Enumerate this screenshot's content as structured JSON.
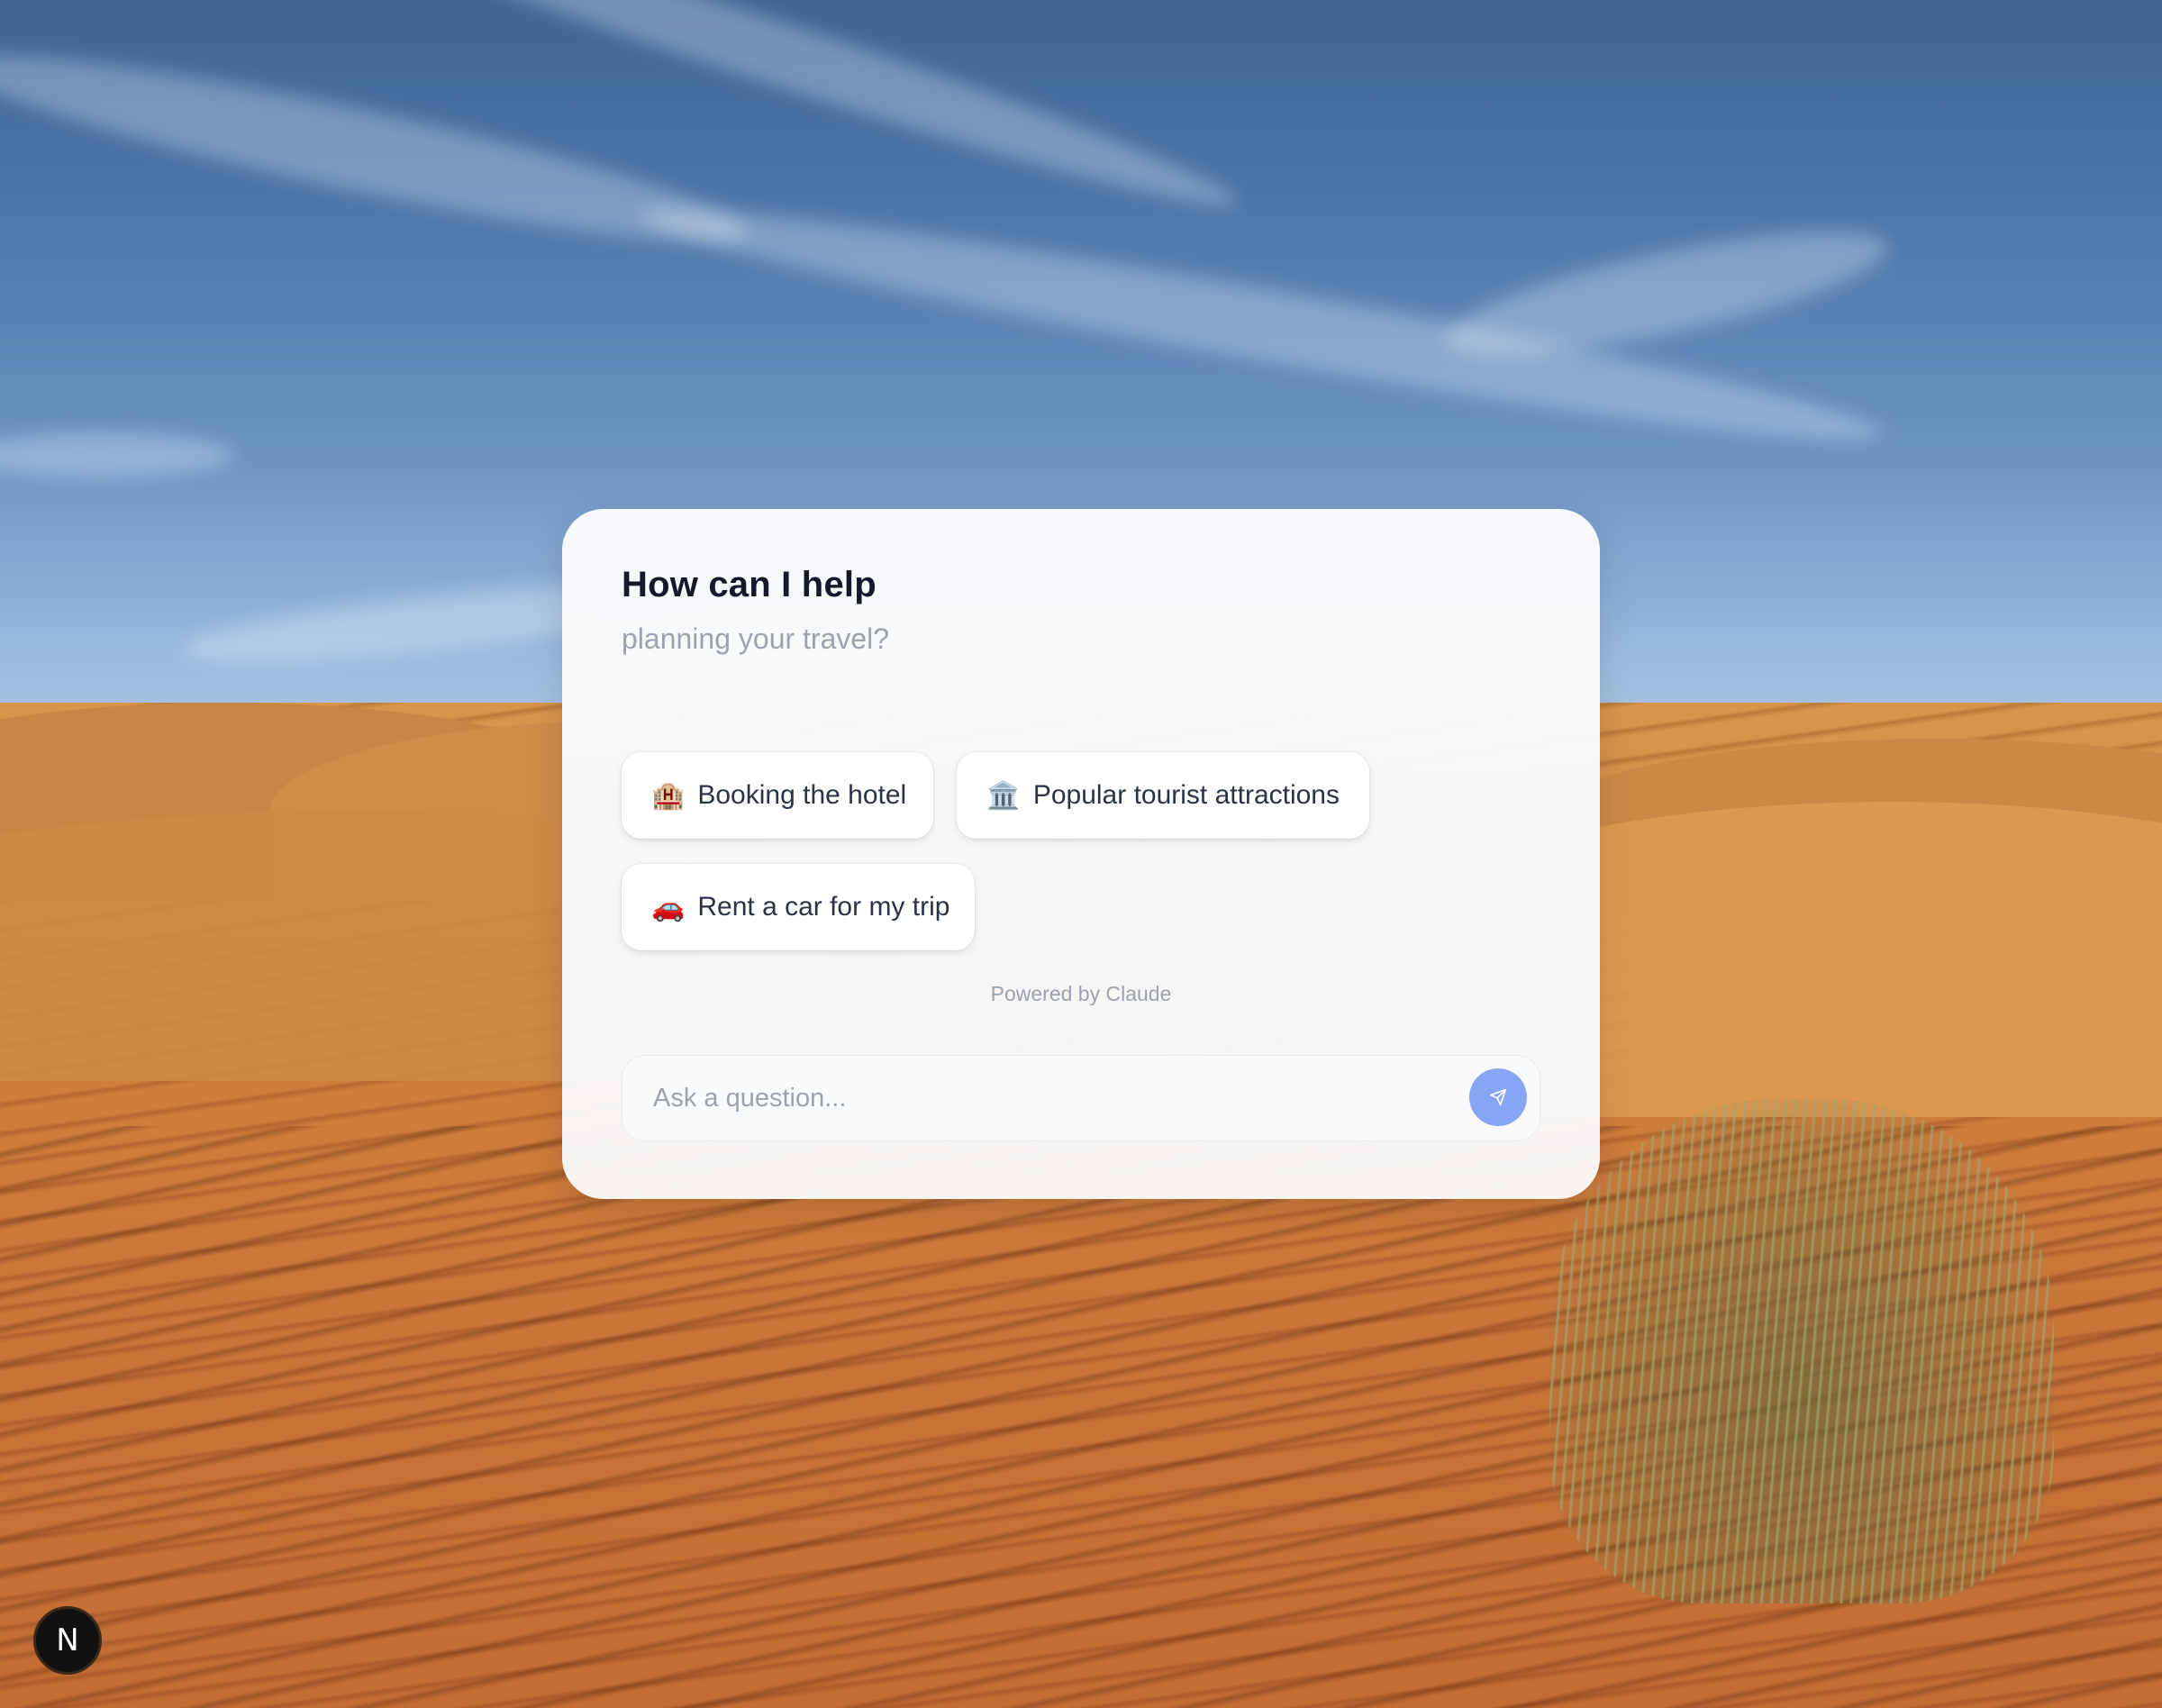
{
  "header": {
    "title": "How can I help",
    "subtitle": "planning your travel?"
  },
  "suggestions": [
    {
      "icon": "hotel-icon",
      "emoji": "🏨",
      "label": "Booking the hotel"
    },
    {
      "icon": "museum-icon",
      "emoji": "🏛️",
      "label": "Popular tourist attractions"
    },
    {
      "icon": "car-icon",
      "emoji": "🚗",
      "label": "Rent a car for my trip"
    }
  ],
  "footer": {
    "powered_by": "Powered by Claude"
  },
  "chat_input": {
    "placeholder": "Ask a question...",
    "send_icon": "send-icon",
    "send_color": "#86a6f5"
  },
  "corner_badge": {
    "letter": "N"
  },
  "colors": {
    "title": "#141a2b",
    "subtitle": "#9ca3af",
    "card": "#f9fafb"
  }
}
